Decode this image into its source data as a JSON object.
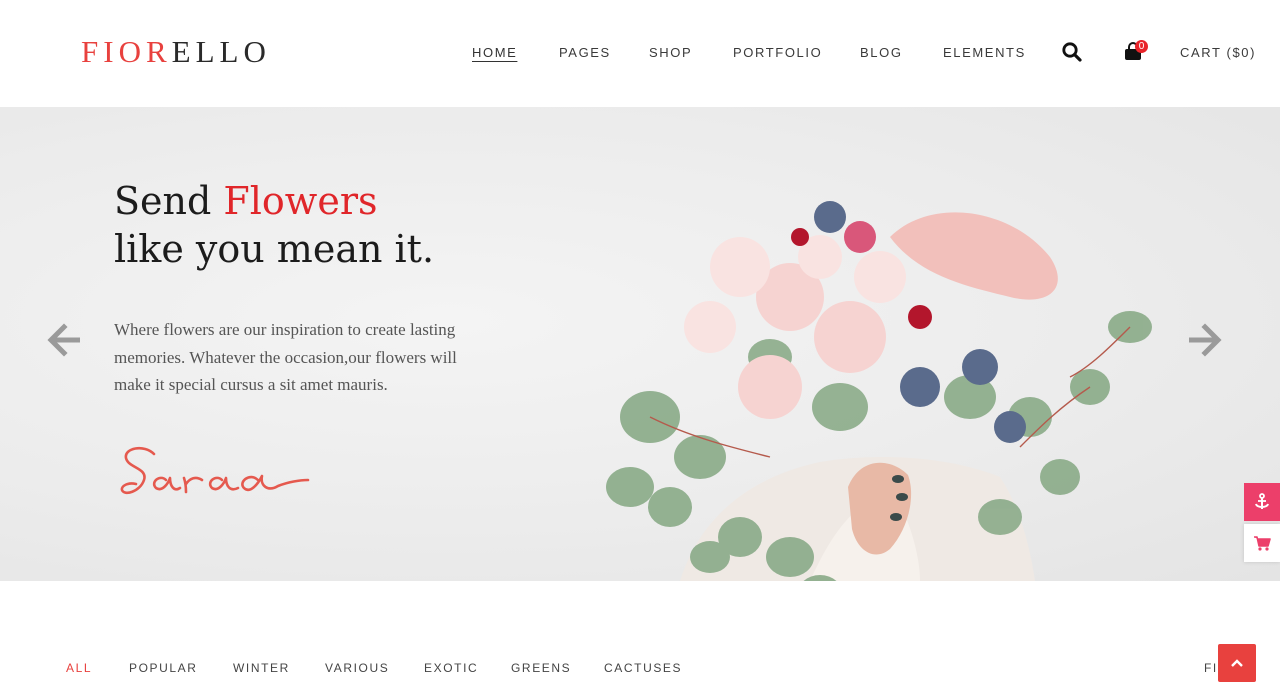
{
  "header": {
    "logo_accent": "FIOR",
    "logo_rest": "ELLO",
    "nav": [
      {
        "label": "HOME"
      },
      {
        "label": "PAGES"
      },
      {
        "label": "SHOP"
      },
      {
        "label": "PORTFOLIO"
      },
      {
        "label": "BLOG"
      },
      {
        "label": "ELEMENTS"
      }
    ],
    "search_icon": "search-icon",
    "cart_icon": "shopping-bag-icon",
    "cart_count": "0",
    "cart_label": "CART ($0)"
  },
  "hero": {
    "title_line1_a": "Send ",
    "title_line1_b": "Flowers",
    "title_line2": "like you mean it.",
    "text": "Where flowers are our inspiration to create lasting memories. Whatever the occasion,our flowers will make it special cursus a sit amet mauris.",
    "signature": "Sara",
    "prev_icon": "arrow-left-icon",
    "next_icon": "arrow-right-icon"
  },
  "side_widgets": {
    "anchor_icon": "anchor-icon",
    "cart_icon": "cart-icon"
  },
  "filters": {
    "items": [
      {
        "label": "ALL"
      },
      {
        "label": "POPULAR"
      },
      {
        "label": "WINTER"
      },
      {
        "label": "VARIOUS"
      },
      {
        "label": "EXOTIC"
      },
      {
        "label": "GREENS"
      },
      {
        "label": "CACTUSES"
      }
    ],
    "right_partial": "FI"
  },
  "colors": {
    "accent": "#e8413e",
    "title_red": "#e0262a",
    "side_pink": "#ec3f6a"
  }
}
